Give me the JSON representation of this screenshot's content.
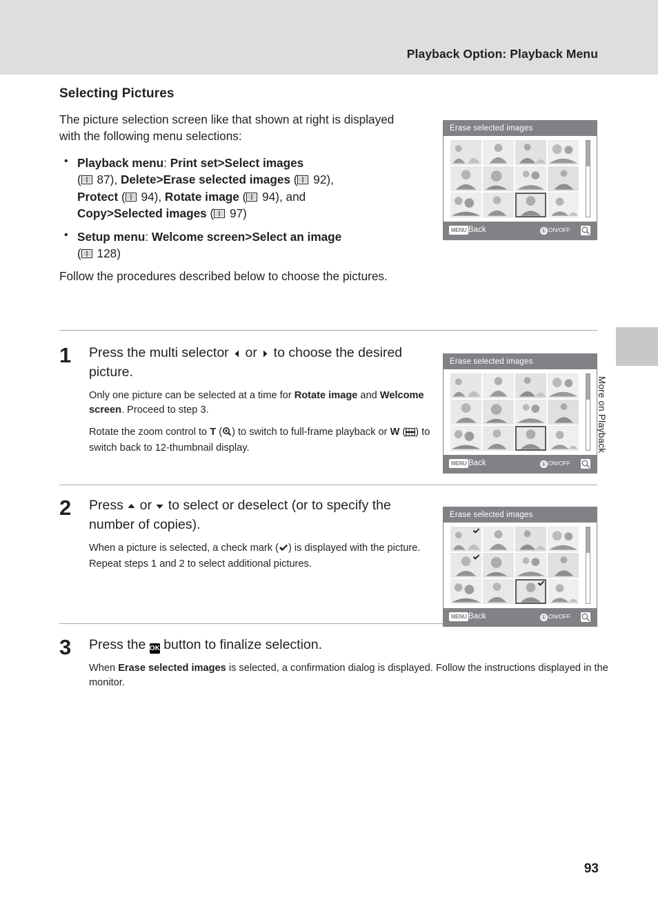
{
  "header": {
    "title": "Playback Option: Playback Menu"
  },
  "side_tab": {
    "label": "More on Playback"
  },
  "page_number": "93",
  "section": {
    "title": "Selecting Pictures",
    "intro": "The picture selection screen like that shown at right is displayed with the following menu selections:",
    "bullets": [
      {
        "lead": "Playback menu",
        "sep": ": ",
        "path1": "Print set",
        "gt1": ">",
        "path2": "Select images",
        "ref1": "87",
        "mid1": ", ",
        "b1": "Delete",
        "gt2": ">",
        "b2": "Erase selected images",
        "ref2": "92",
        "mid2": ", ",
        "b3": "Protect",
        "ref3": "94",
        "mid3": ", ",
        "b4": "Rotate image",
        "ref4": "94",
        "mid4": ", and ",
        "b5": "Copy",
        "gt3": ">",
        "b6": "Selected images",
        "ref5": "97"
      },
      {
        "lead": "Setup menu",
        "sep": ": ",
        "path1": "Welcome screen",
        "gt1": ">",
        "path2": "Select an image",
        "ref1": "128"
      }
    ],
    "follow": "Follow the procedures described below to choose the pictures."
  },
  "steps": [
    {
      "number": "1",
      "head_pre": "Press the multi selector ",
      "head_mid": " or ",
      "head_post": " to choose the desired picture.",
      "paras": [
        {
          "p1": "Only one picture can be selected at a time for ",
          "b1": "Rotate image",
          "p2": " and ",
          "b2": "Welcome screen",
          "p3": ". Proceed to step 3."
        },
        {
          "p1": "Rotate the zoom control to ",
          "b1": "T",
          "p2": " (",
          "icon1": "magnify-plus-icon",
          "p3": ") to switch to full-frame playback or ",
          "b2": "W",
          "p4": " (",
          "icon2": "thumbnail-grid-icon",
          "p5": ") to switch back to 12-thumbnail display."
        }
      ]
    },
    {
      "number": "2",
      "head_pre": "Press ",
      "head_mid": " or ",
      "head_post": " to select or deselect (or to specify the number of copies).",
      "paras": [
        {
          "p1": "When a picture is selected, a check mark (",
          "icon1": "check-mark-icon",
          "p2": ") is displayed with the picture. Repeat steps 1 and 2 to select additional pictures."
        }
      ]
    },
    {
      "number": "3",
      "head_pre": "Press the ",
      "head_btn": "OK",
      "head_post": " button to finalize selection.",
      "paras": [
        {
          "p1": "When ",
          "b1": "Erase selected images",
          "p2": " is selected, a confirmation dialog is displayed. Follow the instructions displayed in the monitor."
        }
      ]
    }
  ],
  "camera_screens": [
    {
      "title": "Erase selected images",
      "back_label": "Back",
      "menu_label": "MENU",
      "onoff_label": "ON/OFF",
      "onoff_glyph": "①",
      "checked": []
    },
    {
      "title": "Erase selected images",
      "back_label": "Back",
      "menu_label": "MENU",
      "onoff_label": "ON/OFF",
      "onoff_glyph": "①",
      "checked": []
    },
    {
      "title": "Erase selected images",
      "back_label": "Back",
      "menu_label": "MENU",
      "onoff_label": "ON/OFF",
      "onoff_glyph": "①",
      "checked": [
        4
      ]
    }
  ]
}
